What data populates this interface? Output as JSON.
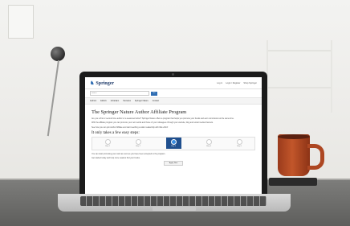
{
  "site": {
    "logo": "Springer",
    "header_links": [
      "Log in",
      "Login / Register",
      "Shop Springer"
    ],
    "search_placeholder": "Search",
    "search_button": "Go",
    "nav": [
      "Authors",
      "Editors",
      "Librarians",
      "Societies",
      "Springer Nature",
      "Contact"
    ]
  },
  "page": {
    "title": "The Springer Nature Author Affiliate Program",
    "paragraphs": [
      "Are you a first or second time author or a seasoned writer? Springer Nature offers a program that helps you promote your books and earn commission at the same time.",
      "With the affiliate program you can promote your own works and those of your colleagues through your website, blog and social media channels.",
      "See how you can join Author Affiliate and start reaching a wider readership with little effort!"
    ],
    "steps_title": "It only takes a few easy steps:",
    "steps": [
      {
        "label": "Step 1"
      },
      {
        "label": "Step 2"
      },
      {
        "label": "Step 3"
      },
      {
        "label": "Step 4"
      },
      {
        "label": "Step 5"
      }
    ],
    "after_steps": [
      "You can start promoting your work as soon as you have been accepted to the program.",
      "Get started today and help more readers find your books."
    ],
    "apply_button": "Apply Now"
  },
  "colors": {
    "brand": "#1f3b6a",
    "accent": "#2f6db3",
    "cup": "#c2562a"
  }
}
